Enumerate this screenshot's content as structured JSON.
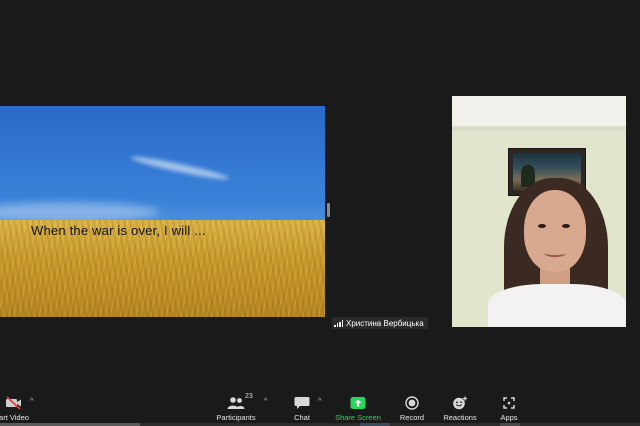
{
  "shared_screen": {
    "caption": "When the war is over, I will ..."
  },
  "participant": {
    "name": "Христина Вербицька"
  },
  "toolbar": {
    "start_video_label": "art Video",
    "participants_label": "Participants",
    "participants_count": "23",
    "chat_label": "Chat",
    "share_screen_label": "Share Screen",
    "record_label": "Record",
    "reactions_label": "Reactions",
    "apps_label": "Apps",
    "caret_glyph": "^",
    "icons": {
      "video": "video-off-icon",
      "participants": "participants-icon",
      "chat": "chat-bubble-icon",
      "share": "share-screen-arrow-icon",
      "record": "record-dot-icon",
      "reactions": "emoji-plus-icon",
      "apps": "apps-icon"
    },
    "accent_color": "#23d959"
  }
}
